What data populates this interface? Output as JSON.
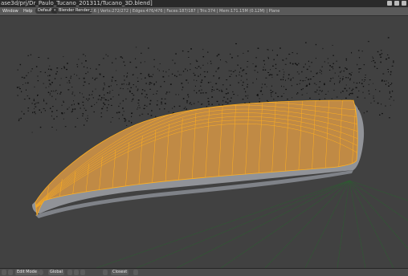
{
  "title_bar": {
    "path_text": "ase3d/prj/Dr_Paulo_Tucano_201311/Tucano_3D.blend]"
  },
  "info_header": {
    "menu_window": "Window",
    "menu_help": "Help",
    "layout_label": "Default",
    "scene_label": "Scene",
    "engine_label": "Blender Render",
    "stats_text": "2.6 | Verts:272/272 | Edges:476/476 | Faces:187/187 | Tris:374 | Mem:171.15M (0.12M) | Plane"
  },
  "bottom_bar": {
    "mode_label": "Edit Mode",
    "pivot_label": "Global",
    "snap_label": "Closest"
  },
  "colors": {
    "mesh_fill": "#c08a45",
    "mesh_edge": "#ffb020",
    "bg": "#414141",
    "grid": "#2f5a33"
  },
  "icons": [
    "camera-icon",
    "view-menu-icon",
    "sphere-shading-icon",
    "vertex-select-icon",
    "edge-select-icon",
    "face-select-icon",
    "magnet-icon",
    "render-icon"
  ]
}
